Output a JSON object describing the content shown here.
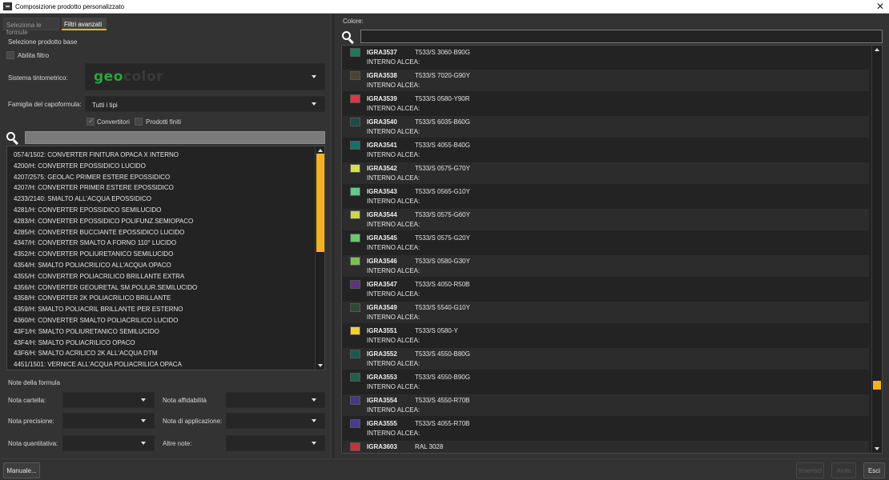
{
  "window": {
    "title": "Composizione prodotto personalizzato",
    "close_glyph": "✕"
  },
  "tabs": [
    {
      "label": "Seleziona le formule",
      "active": false
    },
    {
      "label": "Filtri avanzati",
      "active": true
    }
  ],
  "base_product": {
    "heading": "Selezione prodotto base",
    "enable_filter_label": "Abilita filtro",
    "system_label": "Sistema tintometrico:",
    "system_logo_geo": "geo",
    "system_logo_color": "color",
    "family_label": "Famiglia del capoformula:",
    "family_value": "Tutti i tipi",
    "converters_label": "Convertitori",
    "finished_label": "Prodotti finiti"
  },
  "product_list": [
    "0574/1502: CONVERTER FINITURA OPACA X INTERNO",
    "4200/H: CONVERTER EPOSSIDICO LUCIDO",
    "4207/2575: GEOLAC PRIMER ESTERE EPOSSIDICO",
    "4207/H: CONVERTER PRIMER ESTERE EPOSSIDICO",
    "4233/2140: SMALTO ALL'ACQUA EPOSSIDICO",
    "4281/H: CONVERTER EPOSSIDICO SEMILUCIDO",
    "4283/H: CONVERTER EPOSSIDICO POLIFUNZ.SEMIOPACO",
    "4285/H: CONVERTER BUCCIANTE EPOSSIDICO LUCIDO",
    "4347/H: CONVERTER SMALTO A FORNO 110° LUCIDO",
    "4352/H: CONVERTER POLIURETANICO SEMILUCIDO",
    "4354/H: SMALTO POLIACRILICO ALL'ACQUA OPACO",
    "4355/H: CONVERTER POLIACRILICO BRILLANTE EXTRA",
    "4356/H: CONVERTER GEOURETAL SM.POLIUR.SEMILUCIDO",
    "4358/H: CONVERTER 2K POLIACRILICO BRILLANTE",
    "4359/H: SMALTO POLIACRIL BRILLANTE PER ESTERNO",
    "4360/H: CONVERTER SMALTO POLIACRILICO LUCIDO",
    "43F1/H: SMALTO POLIURETANICO SEMILUCIDO",
    "43F4/H: SMALTO POLIACRILICO OPACO",
    "43F6/H: SMALTO ACRILICO 2K ALL'ACQUA DTM",
    "4451/1501: VERNICE ALL'ACQUA POLIACRILICA OPACA"
  ],
  "notes": {
    "heading": "Note della formula",
    "folder_label": "Nota cartella:",
    "reliability_label": "Nota affidabilità",
    "precision_label": "Nota precisione:",
    "application_label": "Nota di applicazione:",
    "quantity_label": "Nota quantitativa:",
    "other_label": "Altre note:"
  },
  "colors": {
    "heading": "Colore:",
    "items": [
      {
        "code": "IGRA3537",
        "ref": "T533/S 3060-B90G",
        "desc": "INTERNO ALCEA:",
        "swatch": "#1e7a5a"
      },
      {
        "code": "IGRA3538",
        "ref": "T533/S 7020-G90Y",
        "desc": "INTERNO ALCEA:",
        "swatch": "#4a4432"
      },
      {
        "code": "IGRA3539",
        "ref": "T533/S 0580-Y90R",
        "desc": "INTERNO ALCEA:",
        "swatch": "#d63a48"
      },
      {
        "code": "IGRA3540",
        "ref": "T533/S 6035-B60G",
        "desc": "INTERNO ALCEA:",
        "swatch": "#1c4a44"
      },
      {
        "code": "IGRA3541",
        "ref": "T533/S 4055-B40G",
        "desc": "INTERNO ALCEA:",
        "swatch": "#18706c"
      },
      {
        "code": "IGRA3542",
        "ref": "T533/S 0575-G70Y",
        "desc": "INTERNO ALCEA:",
        "swatch": "#d6e048"
      },
      {
        "code": "IGRA3543",
        "ref": "T533/S 0565-G10Y",
        "desc": "INTERNO ALCEA:",
        "swatch": "#64c88c"
      },
      {
        "code": "IGRA3544",
        "ref": "T533/S 0575-G60Y",
        "desc": "INTERNO ALCEA:",
        "swatch": "#c8d84a"
      },
      {
        "code": "IGRA3545",
        "ref": "T533/S 0575-G20Y",
        "desc": "INTERNO ALCEA:",
        "swatch": "#6cc870"
      },
      {
        "code": "IGRA3546",
        "ref": "T533/S 0580-G30Y",
        "desc": "INTERNO ALCEA:",
        "swatch": "#7cc054"
      },
      {
        "code": "IGRA3547",
        "ref": "T533/S 4050-R50B",
        "desc": "INTERNO ALCEA:",
        "swatch": "#5a3478"
      },
      {
        "code": "IGRA3549",
        "ref": "T533/S 5540-G10Y",
        "desc": "INTERNO ALCEA:",
        "swatch": "#2a4a36"
      },
      {
        "code": "IGRA3551",
        "ref": "T533/S 0580-Y",
        "desc": "INTERNO ALCEA:",
        "swatch": "#f2cf3a"
      },
      {
        "code": "IGRA3552",
        "ref": "T533/S 4550-B80G",
        "desc": "INTERNO ALCEA:",
        "swatch": "#1a5a4e"
      },
      {
        "code": "IGRA3553",
        "ref": "T533/S 4550-B90G",
        "desc": "INTERNO ALCEA:",
        "swatch": "#1e604c"
      },
      {
        "code": "IGRA3554",
        "ref": "T533/S 4550-R70B",
        "desc": "INTERNO ALCEA:",
        "swatch": "#463a86"
      },
      {
        "code": "IGRA3555",
        "ref": "T533/S 4055-R70B",
        "desc": "INTERNO ALCEA:",
        "swatch": "#4a3a90"
      },
      {
        "code": "IGRA3603",
        "ref": "RAL 3028",
        "desc": "INTERNO ALCEA:",
        "swatch": "#c8323a"
      }
    ]
  },
  "footer": {
    "manual_label": "Manuale...",
    "btn2_label": "Inserisci",
    "btn3_label": "Aiuto",
    "exit_label": "Esci"
  },
  "accent_color": "#f5b324"
}
